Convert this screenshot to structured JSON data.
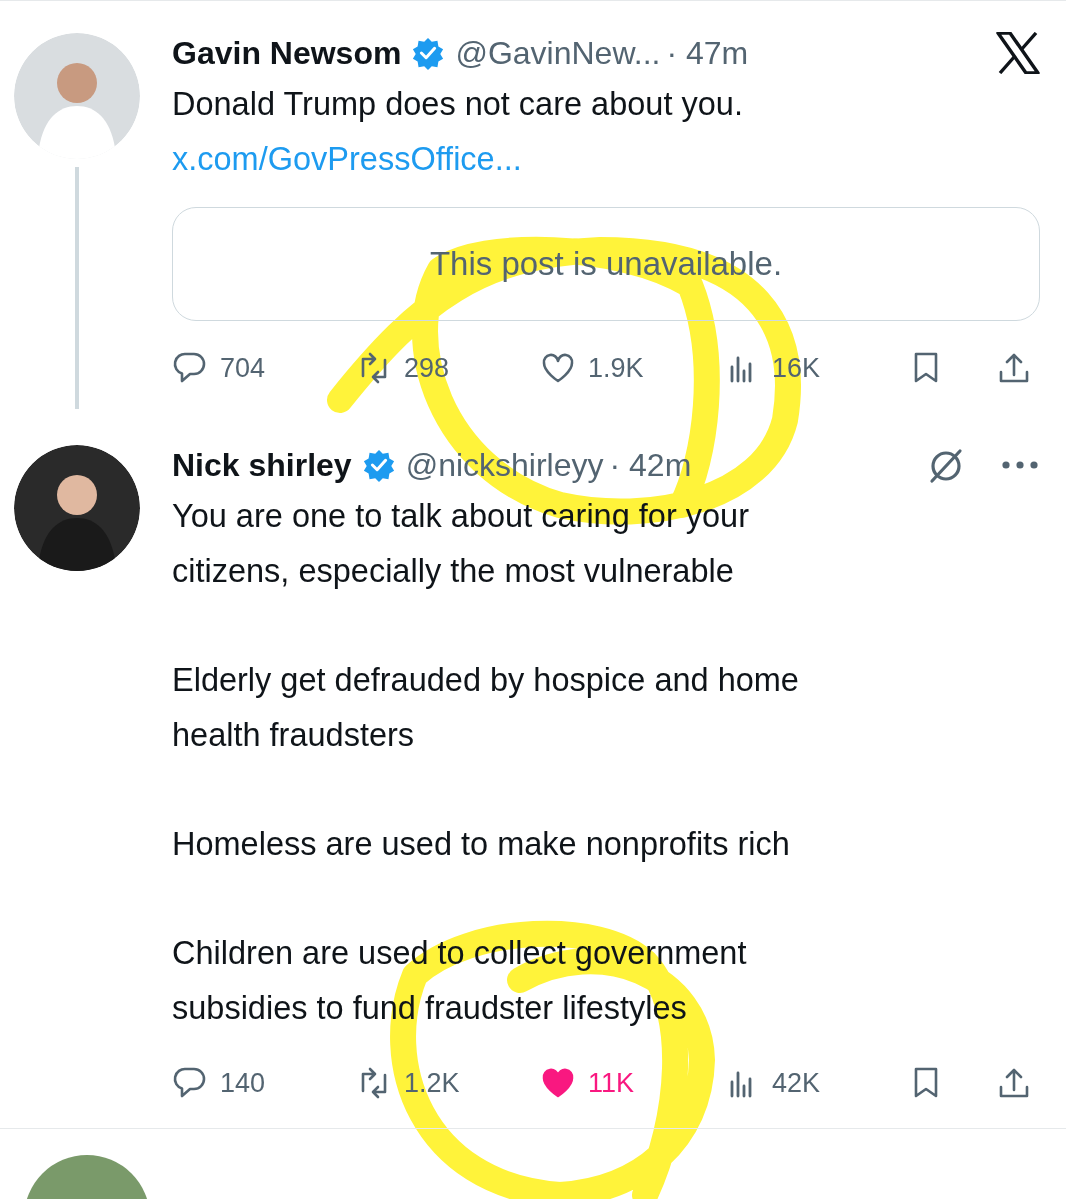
{
  "tweets": [
    {
      "author": "Gavin Newsom",
      "verified": true,
      "handle": "@GavinNew...",
      "time": "· 47m",
      "kind": "branded",
      "thread_below": true,
      "paragraphs": [
        [
          "Donald Trump does not care about you."
        ]
      ],
      "link": "x.com/GovPressOffice...",
      "quote": "This post is unavailable.",
      "stats": {
        "replies": "704",
        "reposts": "298",
        "likes": "1.9K",
        "liked": false,
        "views": "16K"
      }
    },
    {
      "author": "Nick shirley",
      "verified": true,
      "handle": "@nickshirleyy",
      "time": "· 42m",
      "kind": "reply",
      "thread_below": false,
      "paragraphs": [
        [
          "You are one to talk about caring for your",
          "citizens, especially the most vulnerable"
        ],
        [
          "Elderly get defrauded by hospice and home",
          "health fraudsters"
        ],
        [
          "Homeless are used to make nonprofits rich"
        ],
        [
          "Children are used to collect government",
          "subsidies to fund fraudster lifestyles"
        ]
      ],
      "stats": {
        "replies": "140",
        "reposts": "1.2K",
        "likes": "11K",
        "liked": true,
        "views": "42K"
      }
    }
  ]
}
